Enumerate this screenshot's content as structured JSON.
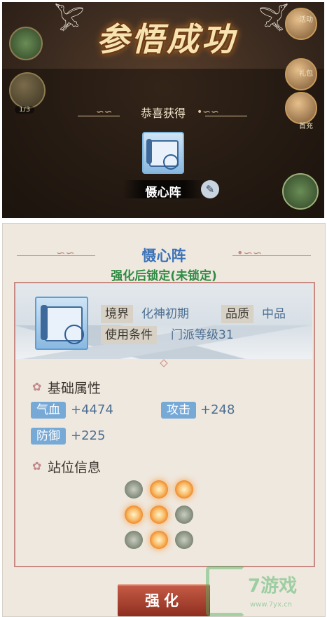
{
  "reward_popup": {
    "title": "参悟成功",
    "congrats_text": "恭喜获得",
    "item_name": "慑心阵",
    "background_labels": {
      "activity": "活动",
      "gift": "礼包",
      "first_recharge": "首充",
      "counter": "1/3"
    }
  },
  "detail": {
    "name": "慑心阵",
    "lock_status": "强化后锁定(未锁定)",
    "realm_label": "境界",
    "realm_value": "化神初期",
    "quality_label": "品质",
    "quality_value": "中品",
    "requirement_label": "使用条件",
    "requirement_value": "门派等级31",
    "base_attr_title": "基础属性",
    "stats": {
      "hp_label": "气血",
      "hp_value": "+4474",
      "atk_label": "攻击",
      "atk_value": "+248",
      "def_label": "防御",
      "def_value": "+225"
    },
    "position_title": "站位信息",
    "formation_grid": [
      [
        "off",
        "on",
        "on"
      ],
      [
        "on",
        "on",
        "off"
      ],
      [
        "off",
        "on",
        "off"
      ]
    ],
    "upgrade_label": "强化"
  },
  "watermark": {
    "brand": "7游戏",
    "url": "www.7yx.cn"
  },
  "colors": {
    "title_gold": "#f7e3b0",
    "name_blue": "#3b73b8",
    "lock_green": "#2f8b43",
    "stat_pill_blue": "#77a9d7",
    "button_red": "#a83c2b"
  },
  "icons": [
    "chat-icon",
    "temple-icon",
    "crane-icon",
    "scroll-item-icon",
    "broom-icon",
    "flower-icon",
    "formation-icon"
  ]
}
